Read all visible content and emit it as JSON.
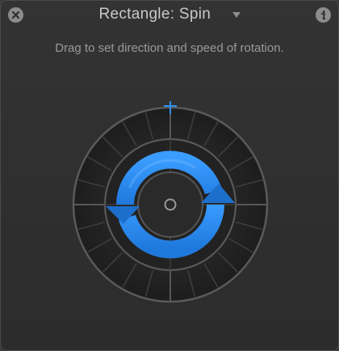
{
  "window": {
    "title": "Rectangle: Spin",
    "instructions": "Drag to set direction and speed of rotation."
  },
  "icons": {
    "close": "close-icon",
    "info": "info-icon",
    "title_menu": "chevron-down-icon",
    "direction_marker": "crosshair-icon",
    "rotation": "rotate-clockwise-arrows-icon"
  },
  "colors": {
    "background": "#2c2c2c",
    "accent_blue": "#2a8cf0",
    "marker_blue": "#2e8ff5",
    "text": "#c9c9c9",
    "subtext": "#9a9a9a"
  }
}
